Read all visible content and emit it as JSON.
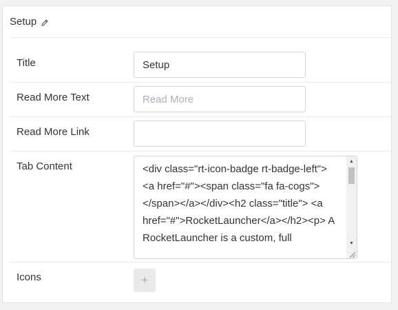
{
  "panel": {
    "title": "Setup",
    "edit_icon": "pencil-icon"
  },
  "fields": {
    "title": {
      "label": "Title",
      "value": "Setup"
    },
    "read_more_text": {
      "label": "Read More Text",
      "value": "",
      "placeholder": "Read More"
    },
    "read_more_link": {
      "label": "Read More Link",
      "value": ""
    },
    "tab_content": {
      "label": "Tab Content",
      "value": "<div class=\"rt-icon-badge rt-badge-left\">        <a href=\"#\"><span class=\"fa fa-cogs\"></span></a></div><h2 class=\"title\">    <a href=\"#\">RocketLauncher</a></h2><p>  A RocketLauncher is a custom, full"
    },
    "icons": {
      "label": "Icons",
      "add_icon": "plus-icon",
      "add_label": "+"
    }
  }
}
